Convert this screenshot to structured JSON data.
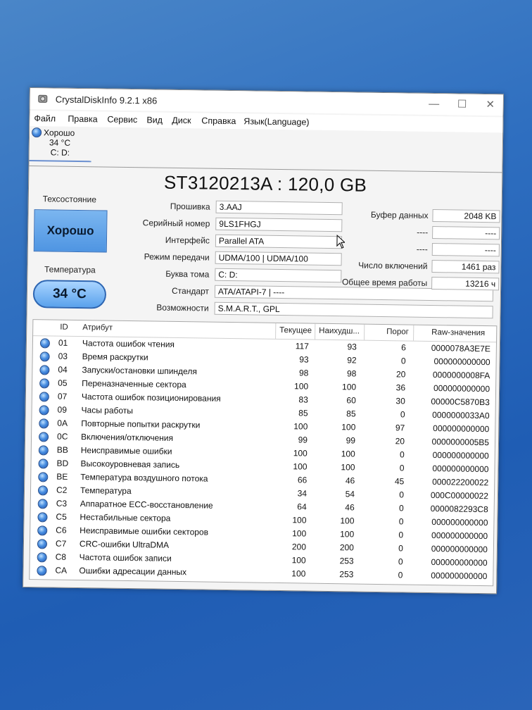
{
  "window": {
    "title": "CrystalDiskInfo 9.2.1 x86",
    "close_glyph": "✕",
    "min_glyph": "—",
    "max_glyph": "☐"
  },
  "menu": [
    "Файл",
    "Правка",
    "Сервис",
    "Вид",
    "Диск",
    "Справка",
    "Язык(Language)"
  ],
  "drive_tab": {
    "status": "Хорошо",
    "temp": "34 °C",
    "letters": "C: D:"
  },
  "model": "ST3120213A : 120,0 GB",
  "health": {
    "label": "Техсостояние",
    "value": "Хорошо"
  },
  "temperature": {
    "label": "Температура",
    "value": "34 °C"
  },
  "info": {
    "firmware": {
      "label": "Прошивка",
      "value": "3.AAJ"
    },
    "serial": {
      "label": "Серийный номер",
      "value": "9LS1FHGJ"
    },
    "interface": {
      "label": "Интерфейс",
      "value": "Parallel ATA"
    },
    "transfer": {
      "label": "Режим передачи",
      "value": "UDMA/100 | UDMA/100"
    },
    "letter": {
      "label": "Буква тома",
      "value": "C: D:"
    },
    "standard": {
      "label": "Стандарт",
      "value": "ATA/ATAPI-7 | ----"
    },
    "features": {
      "label": "Возможности",
      "value": "S.M.A.R.T., GPL"
    }
  },
  "right_info": {
    "buffer": {
      "label": "Буфер данных",
      "value": "2048 KB"
    },
    "blank1": {
      "label": "----",
      "value": "----"
    },
    "blank2": {
      "label": "----",
      "value": "----"
    },
    "power_on_count": {
      "label": "Число включений",
      "value": "1461 раз"
    },
    "power_on_hours": {
      "label": "Общее время работы",
      "value": "13216 ч"
    }
  },
  "table": {
    "headers": {
      "id": "ID",
      "attr": "Атрибут",
      "cur": "Текущее",
      "worst": "Наихудш...",
      "thr": "Порог",
      "raw": "Raw-значения"
    },
    "rows": [
      [
        "01",
        "Частота ошибок чтения",
        "117",
        "93",
        "6",
        "0000078A3E7E"
      ],
      [
        "03",
        "Время раскрутки",
        "93",
        "92",
        "0",
        "000000000000"
      ],
      [
        "04",
        "Запуски/остановки шпинделя",
        "98",
        "98",
        "20",
        "0000000008FA"
      ],
      [
        "05",
        "Переназначенные сектора",
        "100",
        "100",
        "36",
        "000000000000"
      ],
      [
        "07",
        "Частота ошибок позиционирования",
        "83",
        "60",
        "30",
        "00000C5870B3"
      ],
      [
        "09",
        "Часы работы",
        "85",
        "85",
        "0",
        "0000000033A0"
      ],
      [
        "0A",
        "Повторные попытки раскрутки",
        "100",
        "100",
        "97",
        "000000000000"
      ],
      [
        "0C",
        "Включения/отключения",
        "99",
        "99",
        "20",
        "0000000005B5"
      ],
      [
        "BB",
        "Неисправимые ошибки",
        "100",
        "100",
        "0",
        "000000000000"
      ],
      [
        "BD",
        "Высокоуровневая запись",
        "100",
        "100",
        "0",
        "000000000000"
      ],
      [
        "BE",
        "Температура воздушного потока",
        "66",
        "46",
        "45",
        "000022200022"
      ],
      [
        "C2",
        "Температура",
        "34",
        "54",
        "0",
        "000C00000022"
      ],
      [
        "C3",
        "Аппаратное ECC-восстановление",
        "64",
        "46",
        "0",
        "0000082293C8"
      ],
      [
        "C5",
        "Нестабильные сектора",
        "100",
        "100",
        "0",
        "000000000000"
      ],
      [
        "C6",
        "Неисправимые ошибки секторов",
        "100",
        "100",
        "0",
        "000000000000"
      ],
      [
        "C7",
        "CRC-ошибки UltraDMA",
        "200",
        "200",
        "0",
        "000000000000"
      ],
      [
        "C8",
        "Частота ошибок записи",
        "100",
        "253",
        "0",
        "000000000000"
      ],
      [
        "CA",
        "Ошибки адресации данных",
        "100",
        "253",
        "0",
        "000000000000"
      ]
    ]
  }
}
